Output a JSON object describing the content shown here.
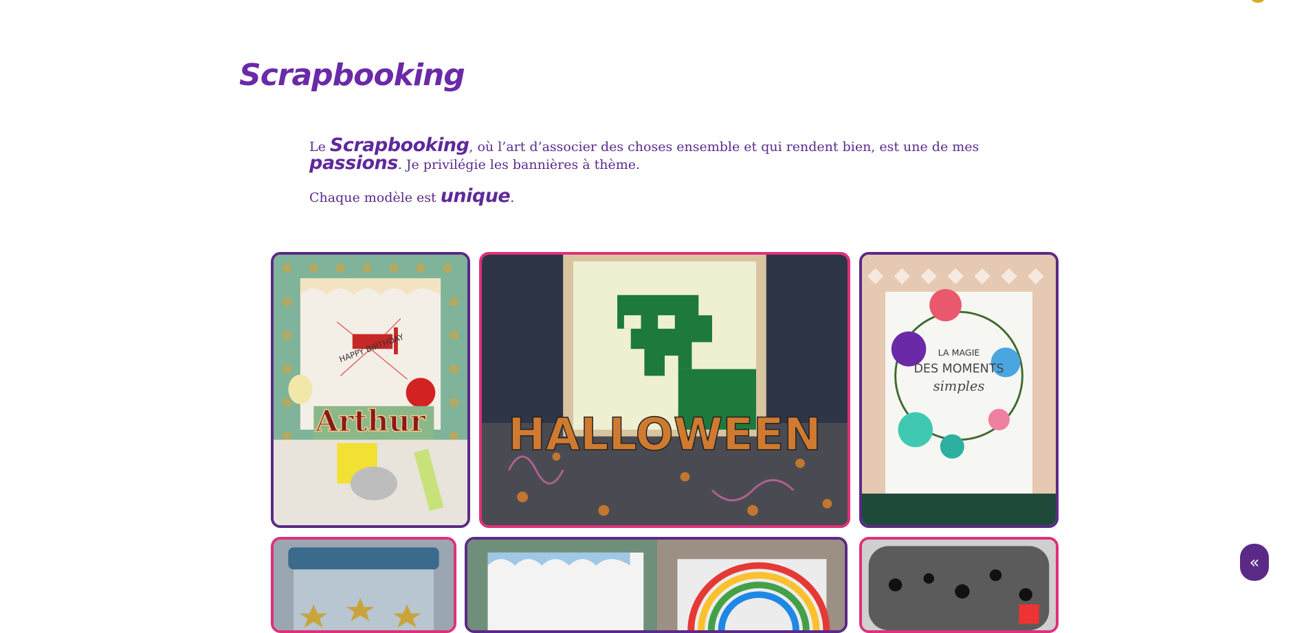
{
  "page": {
    "title": "Scrapbooking",
    "intro": {
      "p1_a": "Le ",
      "p1_hl1": "Scrapbooking",
      "p1_b": ", où l’art d’associer des choses ensemble et qui rendent bien, est une de mes ",
      "p1_hl2": "passions",
      "p1_c": ". Je privilégie les bannières à thème.",
      "p2_a": "Chaque modèle est ",
      "p2_hl": "unique",
      "p2_b": "."
    }
  },
  "gallery": {
    "tiles": [
      {
        "text": "Arthur",
        "banner": "HAPPY BIRTHDAY"
      },
      {
        "text": "HALLOWEEN"
      },
      {
        "text1": "LA MAGIE",
        "text2": "DES MOMENTS",
        "text3": "simples"
      },
      {},
      {},
      {}
    ]
  },
  "nav": {
    "back_label": "«"
  },
  "colors": {
    "accent_purple": "#5b2a86",
    "accent_pink": "#e0307a"
  }
}
